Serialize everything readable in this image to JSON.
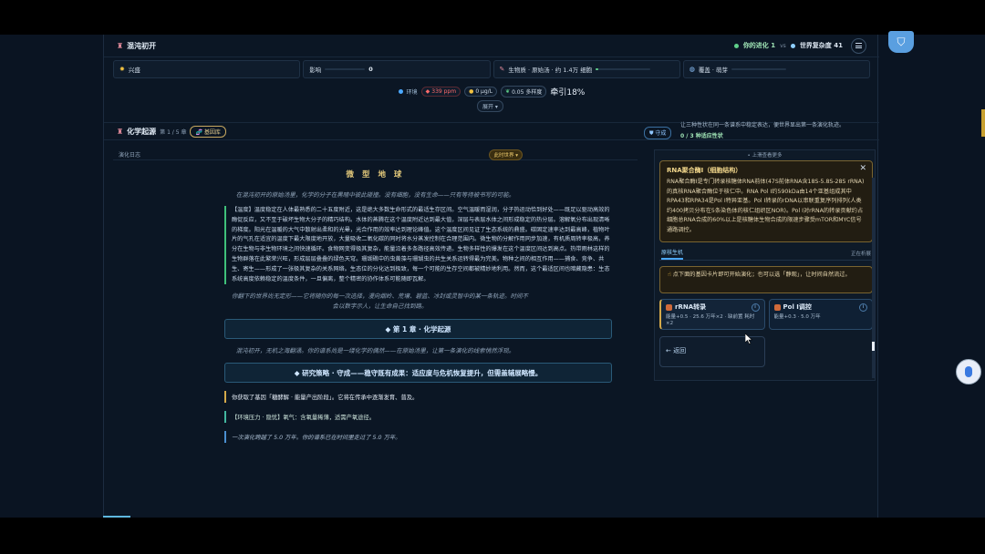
{
  "header": {
    "title": "混沌初开",
    "progress_label": "你的进化 1",
    "vs": "vs",
    "world_label": "世界复杂度 41"
  },
  "stats": {
    "item1_label": "兴盛",
    "item2_label": "影响",
    "item2_value": "0",
    "item3_label": "生物质 · 原始汤 · 约 1.4万 细胞",
    "item4_label": "覆盖 · 萌芽",
    "item3_fill": 0.05
  },
  "env": {
    "label": "环境",
    "co2": "339 ppm",
    "nutrient": "0 μg/L",
    "diversity": "0.05 多样度",
    "pull": "牵引18%",
    "expand": "展开"
  },
  "section": {
    "name": "化学起源",
    "chapter": "第 1 / 5 章",
    "gene_btn": "基因库",
    "guard_btn": "守成",
    "hint": "让三种性状在同一条谱系中稳定表达，便世界显出第一条演化轨迹。",
    "count": "0 / 3 种适应性状"
  },
  "log": {
    "label": "演化日志",
    "world_chip": "此时世界",
    "heading": "微 型 地 球",
    "intro": "在混沌初开的原始汤里，化学的分子在黑暗中彼此碰撞。没有细胞，没有生命——只有等待被书写的可能。",
    "para": "【温度】温度稳定在人体最熟悉的二十五度附近，这是绝大多数生命形式的最适生存区间。空气温暖而湿润，分子热运动恰到好处——既足以驱动高效的酶促反应，又不至于破坏生物大分子的精巧结构。水体的蒸腾在这个温度附近达到最大值，深层与表层水体之间形成稳定的热分层。溶解氧分布出现清晰的梯度。阳光在温暖的大气中散射出柔和的光晕，光合作用的效率达到理论峰值。这个温度区间见证了生态系统的鼎盛。碳固定速率达到最高峰，植物叶片的气孔在适宜的温度下最大限度地开放，大量吸收二氧化碳的同时将水分蒸发控制在合理范围内。微生物的分解作用同步加速，有机质周转率极高，养分在生物与非生物环境之间快速循环。食物网变得极其复杂，能量沿着多条路径高效传递。生物多样性的爆发在这个温度区间达到高点。热带雨林这样的生物群落在此繁荣兴旺，形成层层叠叠的绿色天穹。珊瑚礁中的虫黄藻与珊瑚虫的共生关系运转得最为完美。物种之间的相互作用——捕食、竞争、共生、寄生——形成了一张极其复杂的关系网络。生态位的分化达到极致，每一个可能的生存空间都被精妙地利用。然而，这个最适区间也暗藏隐患：生态系统高度依赖稳定的温度条件，一旦偏离，整个精密的协作体系可能随即瓦解。",
    "italic2": "你翻下的世界尚无定形——它将随你的每一次选择，漫向烟岭、荒壤、碧蓝、冰封或灵智中的某一条轨迹。时间不会以数字示人，让生命自己找到路。",
    "banner1": "◆ 第 1 章 · 化学起源",
    "line_c": "混沌初开，无机之海翻涌。你的谱系尚是一缕化学的偶然——在原始汤里，让第一条演化的线索悄然浮现。",
    "banner2": "◆ 研究策略 · 守成——稳守既有成果：适应度与危机恢复提升，但需盖辅展略慢。",
    "note1": "你获取了基因「糖酵解 · 能量产出阶段」。它将在传承中逐渐发育、普及。",
    "note2": "【环境压力 · 隐忧】氧气：含氧量稀薄，适需产氧途径。",
    "note3": "一次演化跨越了 5.0 万年。你的谱系已在时间里走过了 5.0 万年。"
  },
  "panel": {
    "top": "上滑查看更多",
    "tip_title": "RNA聚合酶I（细胞结构）",
    "tip_body": "RNA聚合酶I是专门转录核糖体RNA前体(47S前体RNA含18S-5.8S-28S rRNA)的真核RNA聚合酶位于核仁中。RNA Pol I约590kDa由14个亚基组成其中RPA43和RPA34是Pol I特异亚基。Pol I转录的rDNA以串联重复序列排列(人类约400拷贝分布在5条染色体的核仁组织区NOR)。Pol I对rRNA的转录贡献约占细胞总RNA合成的60%以上是核糖体生物合成的限速步骤受mTOR和MYC信号通路调控。",
    "tab": "原核生机",
    "tab_right": "正在析展",
    "hint": "点下面的基因卡片即可开始演化；也可以选「静观」，让时间自然流过。",
    "card1_title": "rRNA转录",
    "card1_meta": "能量+0.5 · 25.6 万年×2 · 缺前置 耗时×2",
    "card2_title": "Pol I调控",
    "card2_meta": "能量+0.3 · 5.0 万年",
    "back": "← 返回"
  },
  "colors": {
    "accent_green": "#5fd08a",
    "accent_gold": "#e2c87a",
    "accent_blue": "#4aa8ff"
  }
}
